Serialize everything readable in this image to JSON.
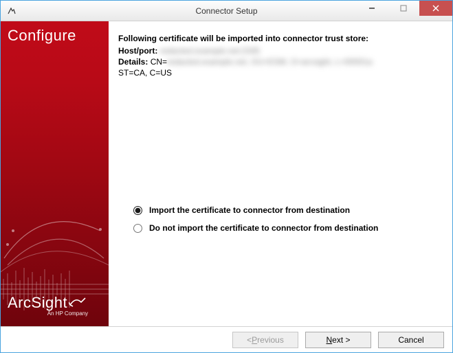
{
  "window": {
    "title": "Connector Setup"
  },
  "sidebar": {
    "title": "Configure",
    "brand": "ArcSight",
    "brand_tag": "An HP Company"
  },
  "main": {
    "heading": "Following certificate will be imported into connector trust store:",
    "hostport_label": "Host/port:",
    "hostport_value": "redacted.example.net:2345",
    "details_label": "Details:",
    "details_value_pre": "CN=",
    "details_value_blur": "redacted.example.net, OU=ESM, O=arcsight, L=00001a",
    "details_value_tail": "ST=CA, C=US",
    "options": {
      "opt1": "Import the certificate to connector from destination",
      "opt2": "Do not import the certificate to connector from destination",
      "selected": "opt1"
    }
  },
  "footer": {
    "previous_pre": "< ",
    "previous_mn": "P",
    "previous_post": "revious",
    "next_mn": "N",
    "next_post": "ext >",
    "cancel": "Cancel"
  }
}
